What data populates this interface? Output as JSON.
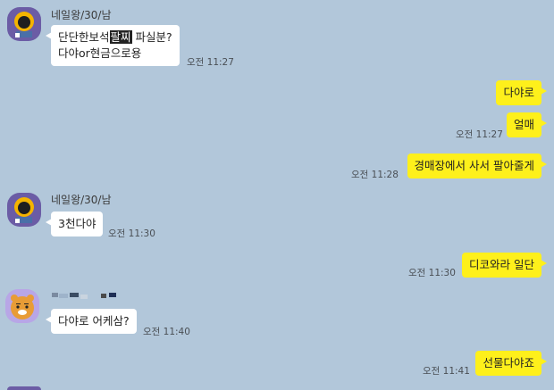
{
  "messages": [
    {
      "sender": "네일왕/30/남",
      "text_a": "단단한보석",
      "text_hl": "팔찌",
      "text_b": " 파실분?",
      "line2": "다야or현금으로용",
      "time": "오전 11:27"
    },
    {
      "text": "다야로"
    },
    {
      "text": "얼매",
      "time": "오전 11:27"
    },
    {
      "text": "경매장에서 사서 팔아줄게",
      "time": "오전 11:28"
    },
    {
      "sender": "네일왕/30/남",
      "text": "3천다야",
      "time": "오전 11:30"
    },
    {
      "text": "디코와라 일단",
      "time": "오전 11:30"
    },
    {
      "text": "다야로 어케삼?",
      "time": "오전 11:40"
    },
    {
      "text": "선물다야죠",
      "time": "오전 11:41"
    }
  ]
}
